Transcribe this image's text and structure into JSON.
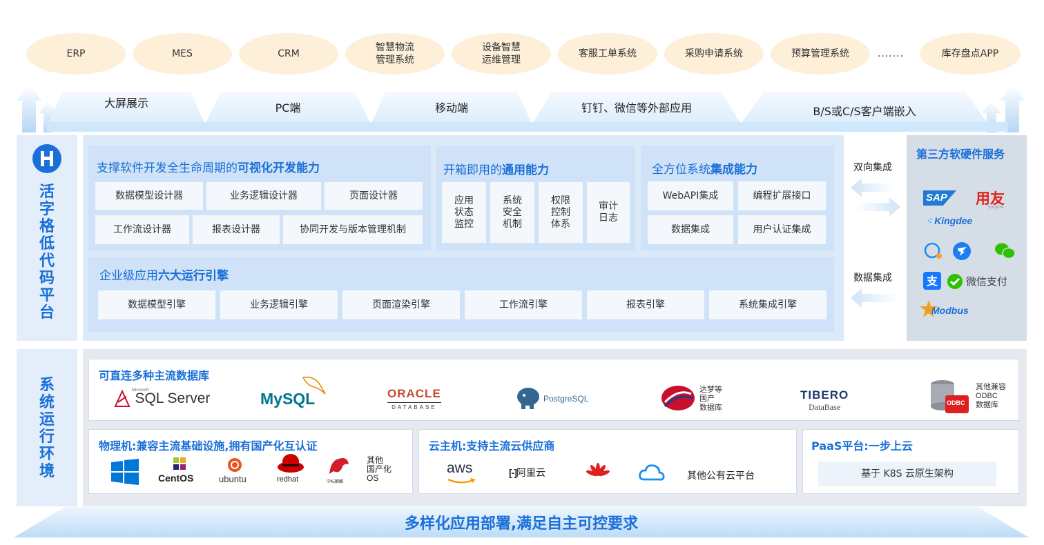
{
  "apps": [
    "ERP",
    "MES",
    "CRM",
    "智慧物流\n管理系统",
    "设备智慧\n运维管理",
    "客服工单系统",
    "采购申请系统",
    "预算管理系统",
    ".......",
    "库存盘点APP"
  ],
  "channels": [
    "大屏展示",
    "PC端",
    "移动端",
    "钉钉、微信等外部应用",
    "B/S或C/S客户端嵌入"
  ],
  "platform_label": "活字格低代码平台",
  "visual": {
    "title_prefix": "支撑软件开发全生命周期的",
    "title_bold": "可视化开发能力",
    "row1": [
      "数据模型设计器",
      "业务逻辑设计器",
      "页面设计器"
    ],
    "row2": [
      "工作流设计器",
      "报表设计器",
      "协同开发与版本管理机制"
    ]
  },
  "general": {
    "title_prefix": "开箱即用的",
    "title_bold": "通用能力",
    "items": [
      "应用\n状态\n监控",
      "系统\n安全\n机制",
      "权限\n控制\n体系",
      "审计\n日志"
    ]
  },
  "integration": {
    "title_prefix": "全方位系统",
    "title_bold": "集成能力",
    "row1": [
      "WebAPI集成",
      "编程扩展接口"
    ],
    "row2": [
      "数据集成",
      "用户认证集成"
    ]
  },
  "engines": {
    "title_prefix": "企业级应用",
    "title_bold": "六大运行引擎",
    "items": [
      "数据模型引擎",
      "业务逻辑引擎",
      "页面渲染引擎",
      "工作流引擎",
      "报表引擎",
      "系统集成引擎"
    ]
  },
  "side_labels": {
    "bidirectional": "双向集成",
    "data": "数据集成"
  },
  "third_party": {
    "title": "第三方软硬件服务",
    "logos": {
      "sap": "SAP",
      "yonyou": "用友",
      "yonyou_sub": "yonyou",
      "kingdee": "Kingdee",
      "wechat_pay": "微信支付",
      "modbus": "Modbus"
    }
  },
  "runtime_label": "系统运行环境",
  "database": {
    "title": "可直连多种主流数据库",
    "sqlserver_small": "Microsoft",
    "sqlserver": "SQL Server",
    "mysql": "MySQL",
    "oracle": "ORACLE",
    "oracle_sub": "DATABASE",
    "postgres": "PostgreSQL",
    "dameng": "达梦等\n国产\n数据库",
    "tibero": "TIBERO",
    "tibero_sub": "DataBase",
    "odbc_badge": "ODBC",
    "odbc": "其他兼容\nODBC\n数据库"
  },
  "physical": {
    "title": "物理机:兼容主流基础设施,拥有国产化互认证",
    "centos": "CentOS",
    "ubuntu": "ubuntu",
    "redhat": "redhat",
    "kylin": "中标麒麟",
    "other": "其他\n国产化\nOS"
  },
  "cloud": {
    "title": "云主机:支持主流云供应商",
    "aws": "aws",
    "aliyun": "阿里云",
    "other": "其他公有云平台"
  },
  "paas": {
    "title": "PaaS平台:一步上云",
    "k8s": "基于 K8S 云原生架构"
  },
  "bottom": "多样化应用部署,满足自主可控要求",
  "colors": {
    "accent": "#1a6fd8",
    "ellipse": "#fdefd8",
    "panel": "#dbeaf9",
    "cell": "#f4f8fd"
  }
}
